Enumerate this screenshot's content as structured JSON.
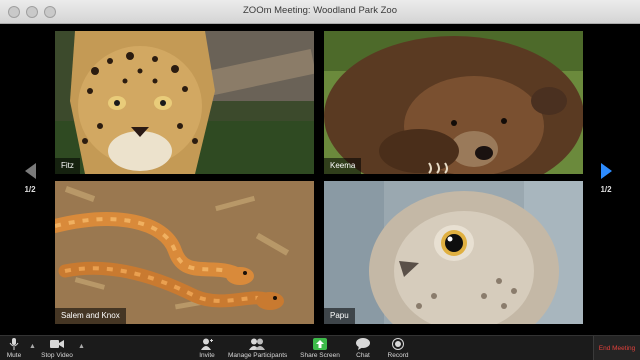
{
  "window": {
    "title": "ZOOm Meeting: Woodland Park Zoo"
  },
  "pager": {
    "left_count": "1/2",
    "right_count": "1/2"
  },
  "participants": [
    {
      "name": "Fitz"
    },
    {
      "name": "Keema"
    },
    {
      "name": "Salem and Knox"
    },
    {
      "name": "Papu"
    }
  ],
  "toolbar": {
    "mute": "Mute",
    "stop_video": "Stop Video",
    "invite": "Invite",
    "manage_participants": "Manage Participants",
    "share_screen": "Share Screen",
    "chat": "Chat",
    "record": "Record",
    "end_meeting": "End Meeting"
  },
  "colors": {
    "accent": "#2d8cff",
    "share_green": "#3dbb4a",
    "end_red": "#e0403b"
  }
}
